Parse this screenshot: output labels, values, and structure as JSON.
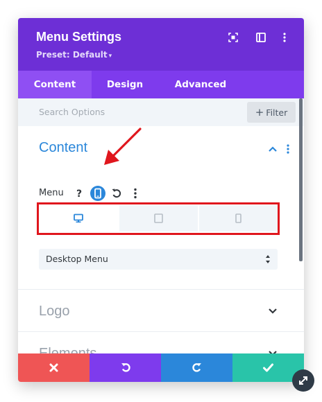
{
  "header": {
    "title": "Menu Settings",
    "preset": "Preset: Default",
    "icons": [
      "screenshot-icon",
      "sidebar-layout-icon",
      "kebab-menu-icon"
    ]
  },
  "tabs": [
    {
      "label": "Content",
      "active": true
    },
    {
      "label": "Design",
      "active": false
    },
    {
      "label": "Advanced",
      "active": false
    }
  ],
  "search": {
    "placeholder": "Search Options",
    "filter_label": "Filter"
  },
  "sections": {
    "content": {
      "title": "Content",
      "expanded": true,
      "menu_field": {
        "label": "Menu",
        "tools": [
          "help-icon",
          "responsive-phone-icon",
          "reset-icon",
          "more-icon"
        ],
        "device_tabs": [
          {
            "name": "desktop",
            "selected": true
          },
          {
            "name": "tablet",
            "selected": false
          },
          {
            "name": "phone",
            "selected": false
          }
        ],
        "select_value": "Desktop Menu"
      }
    },
    "logo": {
      "title": "Logo",
      "expanded": false
    },
    "elements": {
      "title": "Elements",
      "expanded": false
    }
  },
  "footer": {
    "buttons": [
      "close",
      "undo",
      "redo",
      "save"
    ]
  },
  "colors": {
    "header": "#6d2fd6",
    "tabs_bar": "#7e3bed",
    "active_tab": "#8f4ff3",
    "accent_blue": "#2b87da",
    "annotation_red": "#e0161d",
    "cancel": "#ef5555",
    "undo": "#7e3bed",
    "redo": "#2b87da",
    "save": "#29c4a9"
  }
}
